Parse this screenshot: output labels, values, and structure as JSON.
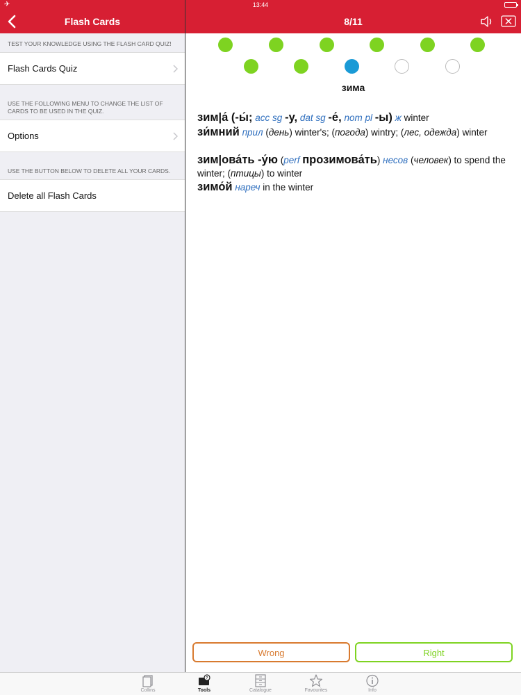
{
  "status_bar": {
    "time": "13:44"
  },
  "left_header": {
    "title": "Flash Cards"
  },
  "right_header": {
    "counter": "8/11"
  },
  "left_panel": {
    "section1_note": "TEST YOUR KNOWLEDGE USING THE FLASH CARD QUIZ!",
    "quiz_label": "Flash Cards Quiz",
    "section2_note": "USE THE FOLLOWING MENU TO CHANGE THE LIST OF CARDS TO BE USED IN THE QUIZ.",
    "options_label": "Options",
    "section3_note": "USE THE BUTTON BELOW TO DELETE ALL YOUR CARDS.",
    "delete_label": "Delete all Flash Cards"
  },
  "progress_dots": [
    "correct",
    "correct",
    "correct",
    "correct",
    "correct",
    "correct",
    "correct",
    "correct",
    "current",
    "unanswered",
    "unanswered"
  ],
  "colors": {
    "brand_red": "#d71f33",
    "correct_green": "#7ed321",
    "current_blue": "#1a9ad6",
    "wrong_orange": "#d87a2f",
    "grammar_blue": "#2f6fbe"
  },
  "card": {
    "headword": "зима",
    "e1": {
      "hw1": "зим|а́ (-ы́;",
      "g1": "acc sg",
      "hw2": "-у,",
      "g2": "dat sg",
      "hw3": "-е́,",
      "g3": "nom pl",
      "hw4": "-ы)",
      "g4": "ж",
      "t1": "winter"
    },
    "e2": {
      "hw1": "зи́мний",
      "g1": "прил",
      "t1": "(",
      "i1": "день",
      "t2": ") winter's; (",
      "i2": "погода",
      "t3": ") wintry; (",
      "i3": "лес, одежда",
      "t4": ") winter"
    },
    "e3": {
      "hw1": "зим|ова́ть -у́ю",
      "t1": "(",
      "g1": "perf",
      "hw2": "прозимова́ть",
      "t2": ")",
      "g2": "несов",
      "t3": "(",
      "i1": "человек",
      "t4": ") to spend the winter; (",
      "i2": "птицы",
      "t5": ") to winter"
    },
    "e4": {
      "hw1": "зимо́й",
      "g1": "нареч",
      "t1": "in the winter"
    }
  },
  "buttons": {
    "wrong": "Wrong",
    "right": "Right"
  },
  "tabbar": {
    "tabs": [
      {
        "label": "Collins",
        "icon": "collins-icon"
      },
      {
        "label": "Tools",
        "icon": "tools-icon"
      },
      {
        "label": "Catalogue",
        "icon": "catalogue-icon"
      },
      {
        "label": "Favourites",
        "icon": "star-icon"
      },
      {
        "label": "Info",
        "icon": "info-icon"
      }
    ],
    "active": "Tools"
  }
}
